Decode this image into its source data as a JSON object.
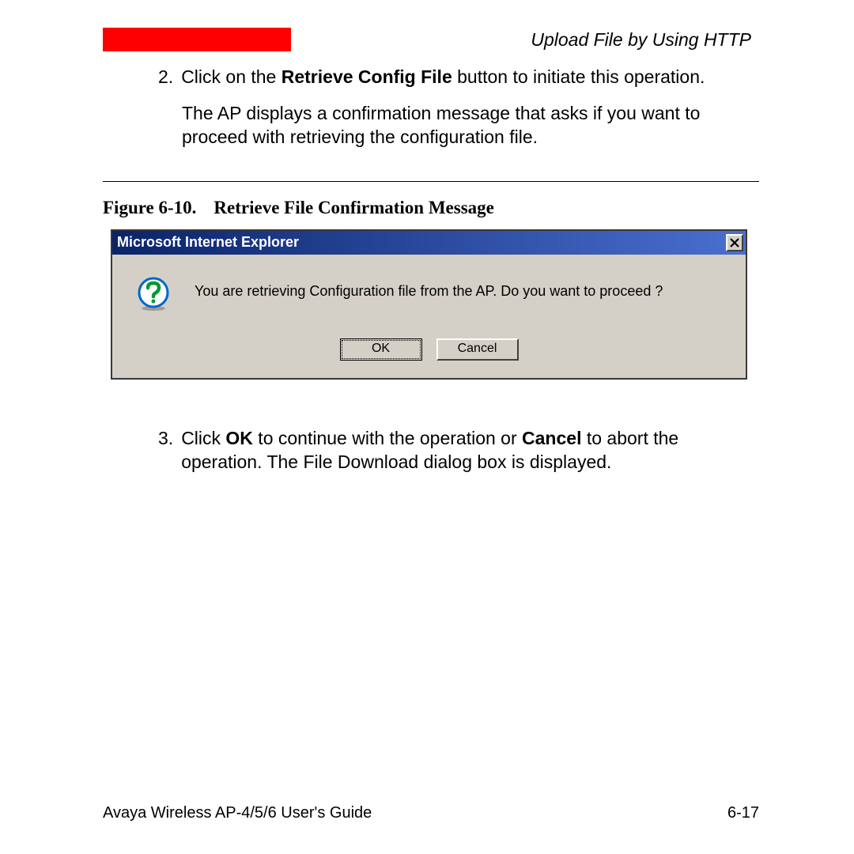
{
  "header": {
    "title": "Upload File by Using HTTP"
  },
  "steps": {
    "step2": {
      "number": "2.",
      "text_before_bold": "Click on the ",
      "bold": "Retrieve Config File",
      "text_after_bold": " button to initiate this operation."
    },
    "step2_para": "The AP displays a confirmation message that asks if you want to proceed with retrieving the configuration file.",
    "step3": {
      "number": "3.",
      "text_1": "Click ",
      "bold_1": "OK",
      "text_2": " to continue with the operation or ",
      "bold_2": "Cancel",
      "text_3": " to abort the operation. The File Download dialog box is displayed."
    }
  },
  "figure": {
    "label": "Figure 6-10.",
    "title": "Retrieve File Confirmation Message"
  },
  "dialog": {
    "title": "Microsoft Internet Explorer",
    "close": "×",
    "message": "You are retrieving Configuration file from the AP. Do you want to proceed ?",
    "ok": "OK",
    "cancel": "Cancel"
  },
  "footer": {
    "guide": "Avaya Wireless AP-4/5/6 User's Guide",
    "page": "6-17"
  }
}
